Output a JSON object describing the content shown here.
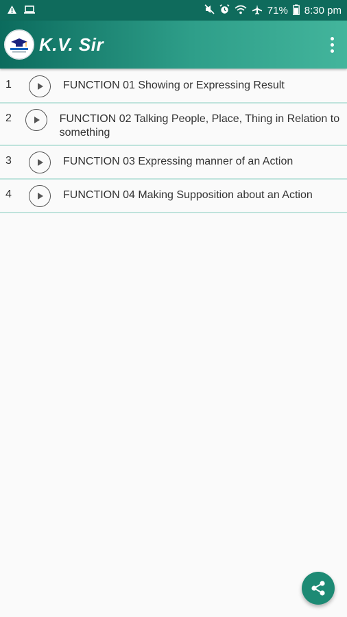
{
  "status_bar": {
    "left_icons": [
      "warning-icon",
      "laptop-icon"
    ],
    "right_icons": [
      "mute-icon",
      "alarm-icon",
      "wifi-icon",
      "airplane-icon",
      "battery-icon"
    ],
    "battery": "71%",
    "time": "8:30 pm"
  },
  "app_bar": {
    "title": "K.V. Sir",
    "logo_icon": "graduation-cap-logo-icon",
    "menu_icon": "overflow-menu-icon"
  },
  "functions": [
    {
      "number": "1",
      "title": "FUNCTION 01 Showing or Expressing Result"
    },
    {
      "number": "2",
      "title": "FUNCTION 02 Talking People, Place, Thing in Relation to something"
    },
    {
      "number": "3",
      "title": "FUNCTION 03 Expressing manner of an Action"
    },
    {
      "number": "4",
      "title": "FUNCTION 04 Making Supposition about an Action"
    }
  ],
  "fab": {
    "icon": "share-icon"
  },
  "colors": {
    "primary": "#0f6b5c",
    "accent": "#1d8a74",
    "divider": "#bfe3dc"
  }
}
